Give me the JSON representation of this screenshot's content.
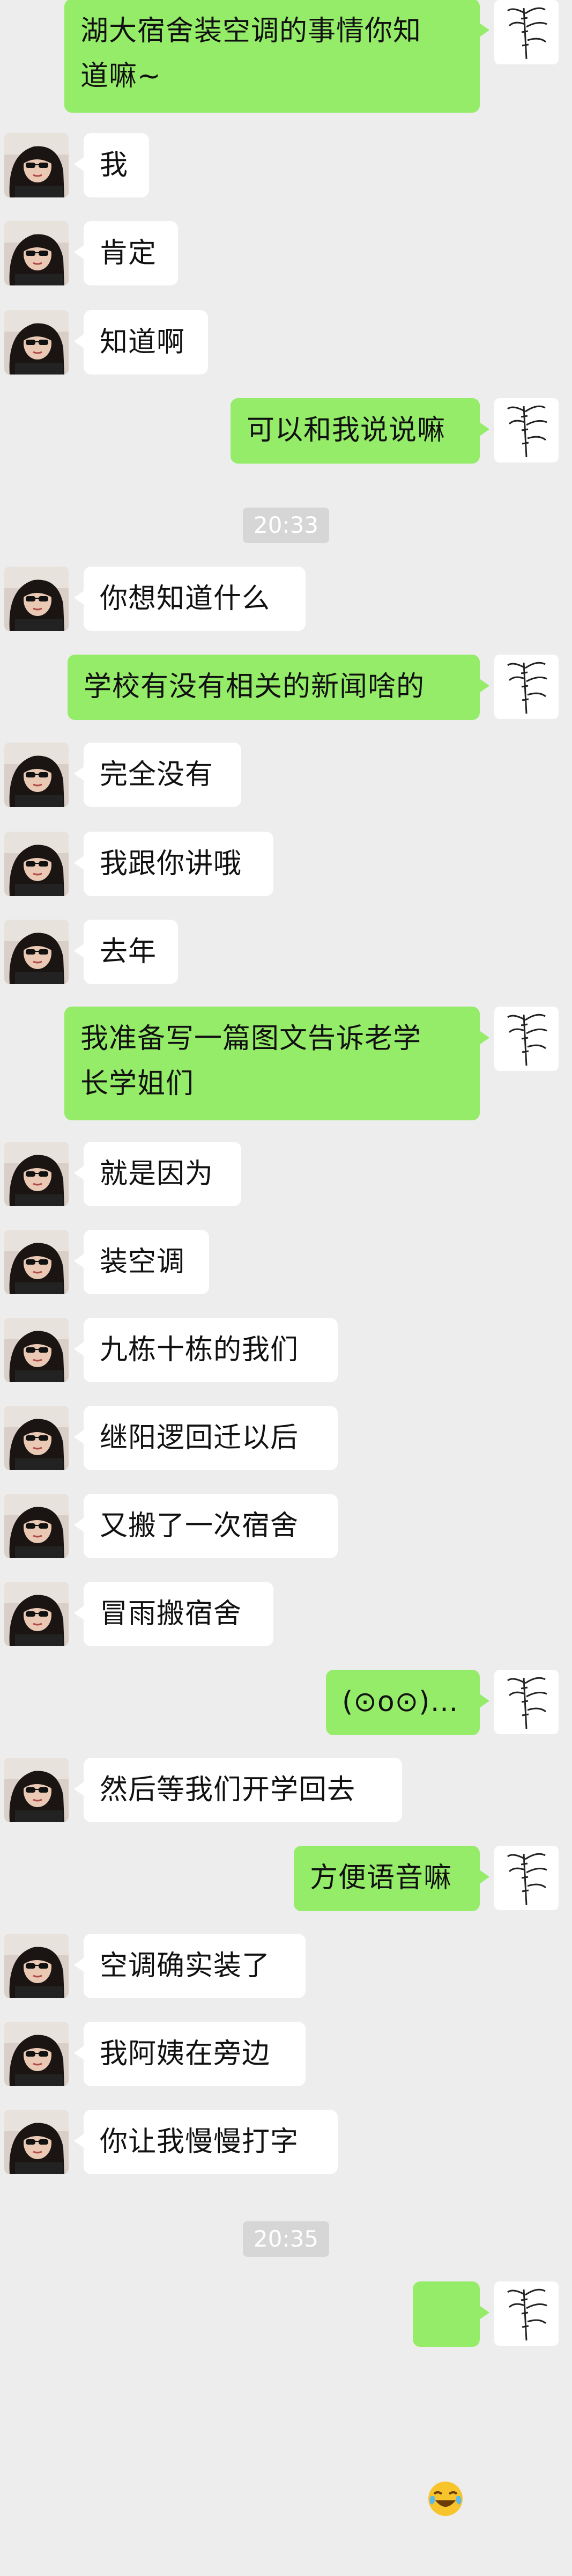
{
  "conversation": {
    "timestamps": [
      "20:33",
      "20:35"
    ],
    "messages": [
      {
        "side": "out",
        "text": "湖大宿舍装空调的事情你知\n道嘛~"
      },
      {
        "side": "in",
        "text": "我"
      },
      {
        "side": "in",
        "text": "肯定"
      },
      {
        "side": "in",
        "text": "知道啊"
      },
      {
        "side": "out",
        "text": "可以和我说说嘛"
      },
      {
        "side": "in",
        "text": "你想知道什么"
      },
      {
        "side": "out",
        "text": "学校有没有相关的新闻啥的"
      },
      {
        "side": "in",
        "text": "完全没有"
      },
      {
        "side": "in",
        "text": "我跟你讲哦"
      },
      {
        "side": "in",
        "text": "去年"
      },
      {
        "side": "out",
        "text": "我准备写一篇图文告诉老学\n长学姐们"
      },
      {
        "side": "in",
        "text": "就是因为"
      },
      {
        "side": "in",
        "text": "装空调"
      },
      {
        "side": "in",
        "text": "九栋十栋的我们"
      },
      {
        "side": "in",
        "text": "继阳逻回迁以后"
      },
      {
        "side": "in",
        "text": "又搬了一次宿舍"
      },
      {
        "side": "in",
        "text": "冒雨搬宿舍"
      },
      {
        "side": "out",
        "text": "(⊙o⊙)…"
      },
      {
        "side": "in",
        "text": "然后等我们开学回去"
      },
      {
        "side": "out",
        "text": "方便语音嘛"
      },
      {
        "side": "in",
        "text": "空调确实装了"
      },
      {
        "side": "in",
        "text": "我阿姨在旁边"
      },
      {
        "side": "in",
        "text": "你让我慢慢打字"
      },
      {
        "side": "out",
        "emoji": "laughing-crying-emoji"
      }
    ]
  },
  "avatars": {
    "contact": "contact-avatar-photo",
    "self": "bamboo-avatar"
  },
  "colors": {
    "background": "#ededed",
    "incoming_bubble": "#ffffff",
    "outgoing_bubble": "#95ec69",
    "timestamp_bg": "#d6d6d6"
  }
}
